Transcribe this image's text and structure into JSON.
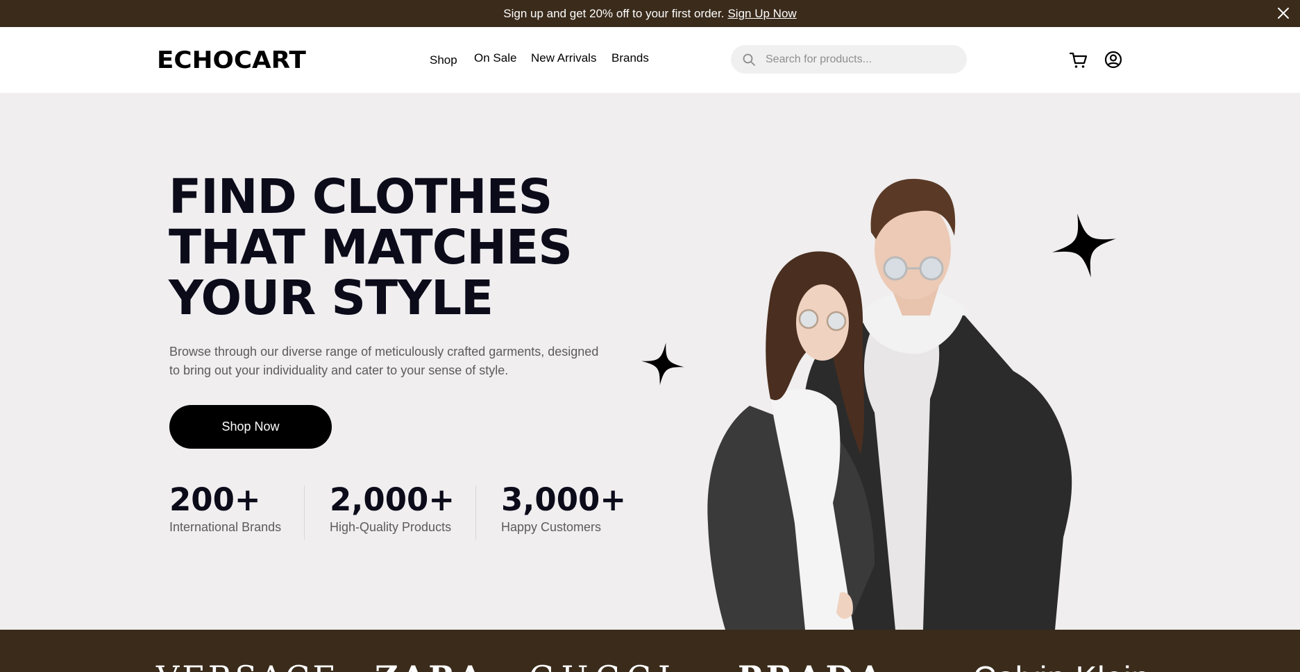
{
  "announcement": {
    "message": "Sign up and get 20% off to your first order.",
    "link_label": "Sign Up Now"
  },
  "header": {
    "logo": "ECHOCART",
    "nav": [
      {
        "label": "Shop"
      },
      {
        "label": "On Sale"
      },
      {
        "label": "New Arrivals"
      },
      {
        "label": "Brands"
      }
    ],
    "search_placeholder": "Search for products..."
  },
  "hero": {
    "title_lines": [
      "FIND CLOTHES",
      "THAT MATCHES",
      "YOUR STYLE"
    ],
    "description": "Browse through our diverse range of meticulously crafted garments, designed to bring out your individuality and cater to your sense of style.",
    "cta_label": "Shop Now",
    "stats": [
      {
        "value": "200+",
        "label": "International Brands"
      },
      {
        "value": "2,000+",
        "label": "High-Quality Products"
      },
      {
        "value": "3,000+",
        "label": "Happy Customers"
      }
    ]
  },
  "brands": {
    "items": [
      "VERSACE",
      "ZARA",
      "GUCCI",
      "PRADA",
      "Calvin Klein"
    ]
  },
  "colors": {
    "announcement_bg": "#3a2b1b",
    "hero_bg": "#f0eeef",
    "title": "#0b0b1a",
    "button_bg": "#000000"
  }
}
